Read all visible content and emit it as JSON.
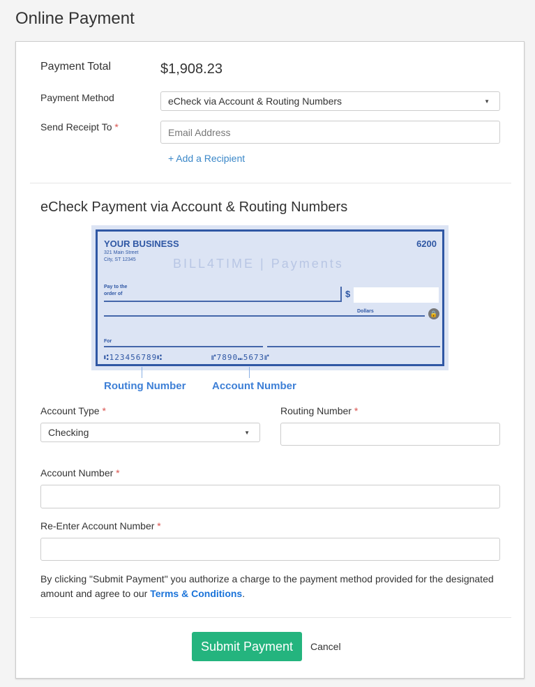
{
  "page": {
    "title": "Online Payment"
  },
  "form": {
    "payment_total_label": "Payment Total",
    "payment_total": "$1,908.23",
    "payment_method_label": "Payment Method",
    "payment_method": "eCheck via Account & Routing Numbers",
    "receipt_label": "Send Receipt To",
    "required_mark": "*",
    "email_placeholder": "Email Address",
    "add_recipient": "+ Add a Recipient"
  },
  "echeck": {
    "heading": "eCheck Payment via Account & Routing Numbers",
    "check": {
      "business": "YOUR BUSINESS",
      "address1": "321 Main Street",
      "address2": "City, ST 12345",
      "number": "6200",
      "logo": "BILL4TIME | Payments",
      "pay_to": "Pay to the",
      "order_of": "order of",
      "dollar": "$",
      "dollars": "Dollars",
      "for": "For",
      "routing_micr": "⑆123456789⑆",
      "account_micr": "⑈7890⑉5673⑈"
    },
    "routing_caption": "Routing Number",
    "account_caption": "Account Number",
    "account_type_label": "Account Type",
    "account_type": "Checking",
    "routing_label": "Routing Number",
    "account_number_label": "Account Number",
    "reenter_label": "Re-Enter Account Number",
    "disclaimer_pre": "By clicking \"Submit Payment\" you authorize a charge to the payment method provided for the designated amount and agree to our ",
    "terms": "Terms & Conditions",
    "disclaimer_post": "."
  },
  "actions": {
    "submit": "Submit Payment",
    "cancel": "Cancel"
  },
  "colors": {
    "accent": "#24b47e",
    "link": "#3a87c8",
    "check_blue": "#2f57a4"
  }
}
